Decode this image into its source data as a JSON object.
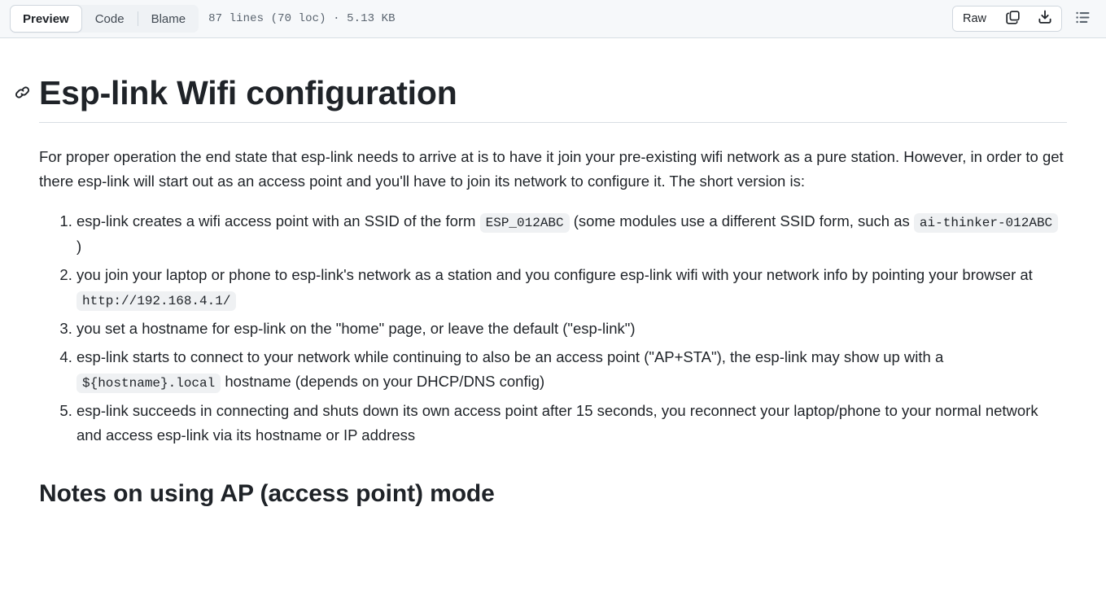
{
  "header": {
    "tabs": [
      {
        "label": "Preview",
        "selected": true
      },
      {
        "label": "Code",
        "selected": false
      },
      {
        "label": "Blame",
        "selected": false
      }
    ],
    "file_meta": "87 lines (70 loc) · 5.13 KB",
    "raw_label": "Raw",
    "icons": {
      "copy": "copy-icon",
      "download": "download-icon",
      "outline": "outline-list-icon"
    }
  },
  "document": {
    "anchor_icon": "link-anchor-icon",
    "title": "Esp-link Wifi configuration",
    "intro": "For proper operation the end state that esp-link needs to arrive at is to have it join your pre-existing wifi network as a pure station. However, in order to get there esp-link will start out as an access point and you'll have to join its network to configure it. The short version is:",
    "steps": [
      {
        "parts": [
          {
            "type": "text",
            "value": "esp-link creates a wifi access point with an SSID of the form "
          },
          {
            "type": "code",
            "value": "ESP_012ABC"
          },
          {
            "type": "text",
            "value": " (some modules use a different SSID form, such as "
          },
          {
            "type": "code",
            "value": "ai-thinker-012ABC"
          },
          {
            "type": "text",
            "value": " )"
          }
        ]
      },
      {
        "parts": [
          {
            "type": "text",
            "value": "you join your laptop or phone to esp-link's network as a station and you configure esp-link wifi with your network info by pointing your browser at "
          },
          {
            "type": "code",
            "value": "http://192.168.4.1/"
          }
        ]
      },
      {
        "parts": [
          {
            "type": "text",
            "value": "you set a hostname for esp-link on the \"home\" page, or leave the default (\"esp-link\")"
          }
        ]
      },
      {
        "parts": [
          {
            "type": "text",
            "value": "esp-link starts to connect to your network while continuing to also be an access point (\"AP+STA\"), the esp-link may show up with a "
          },
          {
            "type": "code",
            "value": "${hostname}.local"
          },
          {
            "type": "text",
            "value": " hostname (depends on your DHCP/DNS config)"
          }
        ]
      },
      {
        "parts": [
          {
            "type": "text",
            "value": "esp-link succeeds in connecting and shuts down its own access point after 15 seconds, you reconnect your laptop/phone to your normal network and access esp-link via its hostname or IP address"
          }
        ]
      }
    ],
    "section_heading": "Notes on using AP (access point) mode"
  },
  "colors": {
    "header_bg": "#f6f8fa",
    "border": "#d8dee4",
    "text": "#1f2328",
    "muted": "#59636e",
    "code_bg": "#eff1f3"
  }
}
